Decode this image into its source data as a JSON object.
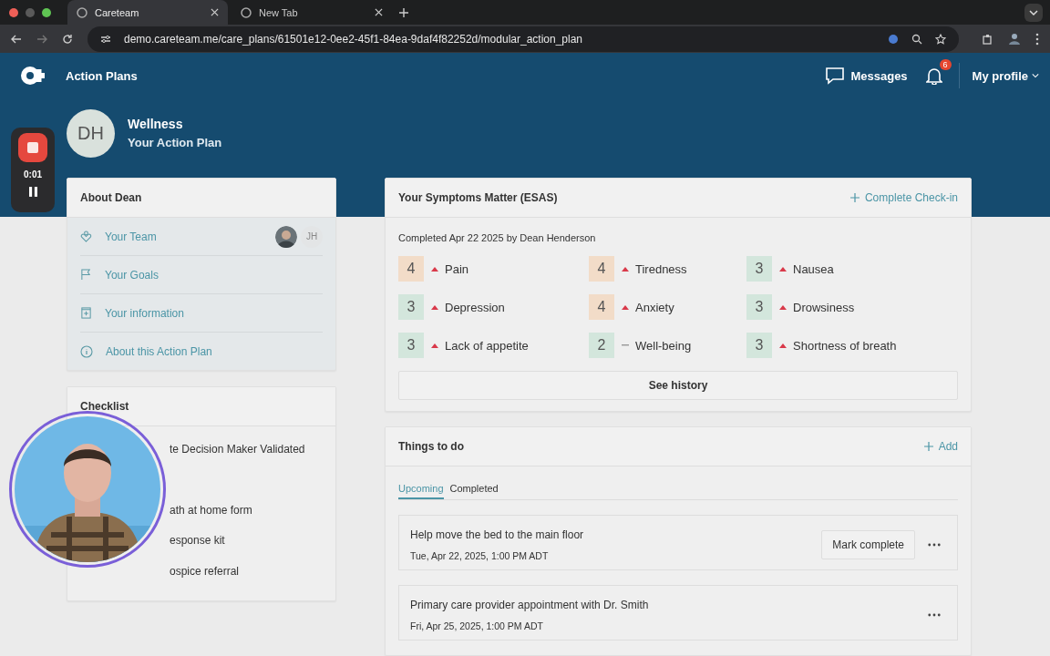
{
  "browser": {
    "tabs": [
      {
        "title": "Careteam",
        "selected": true
      },
      {
        "title": "New Tab",
        "selected": false
      }
    ],
    "url": "demo.careteam.me/care_plans/61501e12-0ee2-45f1-84ea-9daf4f82252d/modular_action_plan"
  },
  "header": {
    "section": "Action Plans",
    "messages": "Messages",
    "notifications": "6",
    "profile": "My profile"
  },
  "recorder": {
    "time": "0:01"
  },
  "plan": {
    "initials": "DH",
    "title": "Wellness",
    "subtitle": "Your Action Plan"
  },
  "about": {
    "title": "About Dean",
    "items": [
      {
        "label": "Your Team",
        "kind": "team",
        "member": "JH"
      },
      {
        "label": "Your Goals",
        "kind": "goals"
      },
      {
        "label": "Your information",
        "kind": "information"
      },
      {
        "label": "About this Action Plan",
        "kind": "about"
      }
    ]
  },
  "checklist": {
    "title": "Checklist",
    "items": [
      "te Decision Maker Validated",
      "ath at home form",
      "esponse kit",
      "ospice referral"
    ]
  },
  "symptoms": {
    "title": "Your Symptoms Matter (ESAS)",
    "action": "Complete Check-in",
    "completed": "Completed Apr 22 2025 by Dean Henderson",
    "items": [
      {
        "score": "4",
        "name": "Pain",
        "rising": true,
        "color": "#f2dcc8"
      },
      {
        "score": "4",
        "name": "Tiredness",
        "rising": true,
        "color": "#f2dcc8"
      },
      {
        "score": "3",
        "name": "Nausea",
        "rising": true,
        "color": "#d3e6dc"
      },
      {
        "score": "3",
        "name": "Depression",
        "rising": true,
        "color": "#d3e6dc"
      },
      {
        "score": "4",
        "name": "Anxiety",
        "rising": true,
        "color": "#f2dcc8"
      },
      {
        "score": "3",
        "name": "Drowsiness",
        "rising": true,
        "color": "#d3e6dc"
      },
      {
        "score": "3",
        "name": "Lack of appetite",
        "rising": true,
        "color": "#d3e6dc"
      },
      {
        "score": "2",
        "name": "Well-being",
        "rising": false,
        "color": "#d3e6dc"
      },
      {
        "score": "3",
        "name": "Shortness of breath",
        "rising": true,
        "color": "#d3e6dc"
      }
    ],
    "history": "See history"
  },
  "todo": {
    "title": "Things to do",
    "add": "Add",
    "tabs": [
      {
        "label": "Upcoming",
        "selected": true
      },
      {
        "label": "Completed",
        "selected": false
      }
    ],
    "tasks": [
      {
        "title": "Help move the bed to the main floor",
        "date": "Tue, Apr 22, 2025, 1:00 PM ADT",
        "action": "Mark complete"
      },
      {
        "title": "Primary care provider appointment with Dr. Smith",
        "date": "Fri, Apr 25, 2025, 1:00 PM ADT"
      }
    ]
  }
}
